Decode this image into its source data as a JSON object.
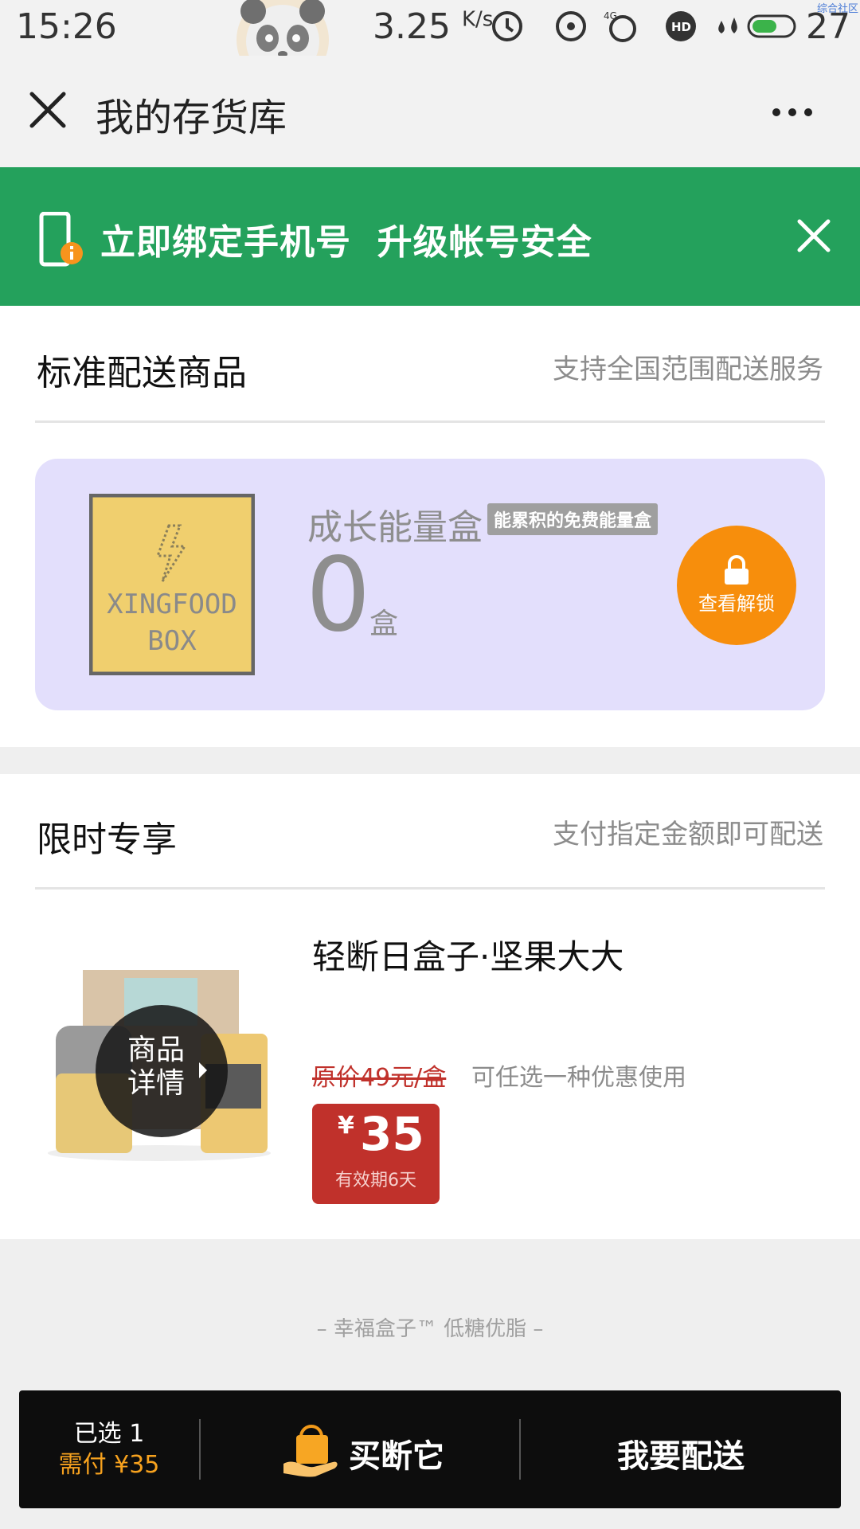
{
  "status_bar": {
    "time": "15:26",
    "net_speed": "3.25",
    "net_speed_unit": "K/s",
    "battery_level": "27",
    "watermark": "综合社区"
  },
  "header": {
    "title": "我的存货库"
  },
  "bind_banner": {
    "text": "立即绑定手机号  升级帐号安全"
  },
  "standard": {
    "title": "标准配送商品",
    "subtitle": "支持全国范围配送服务",
    "card": {
      "box_text_line1": "XINGFOOD",
      "box_text_line2": "BOX",
      "name": "成长能量盒",
      "badge": "能累积的免费能量盒",
      "count": "0",
      "unit": "盒",
      "unlock_label": "查看解锁"
    }
  },
  "limited": {
    "title": "限时专享",
    "subtitle": "支付指定金额即可配送",
    "product": {
      "name": "轻断日盒子·坚果大大",
      "detail_label": "商品详情",
      "original_price": "原价49元/盒",
      "promo_note": "可任选一种优惠使用",
      "price_symbol": "¥",
      "price": "35",
      "validity": "有效期6天"
    }
  },
  "footer": {
    "slogan": "– 幸福盒子™ 低糖优脂 –"
  },
  "action_bar": {
    "selected": "已选 1",
    "need_pay": "需付 ¥35",
    "buyout_label": "买断它",
    "deliver_label": "我要配送"
  },
  "colors": {
    "banner_green": "#24a15c",
    "unlock_orange": "#f78e0c",
    "price_red": "#c0312b",
    "card_lavender": "#e3dffc",
    "pay_orange": "#f7a21e"
  }
}
